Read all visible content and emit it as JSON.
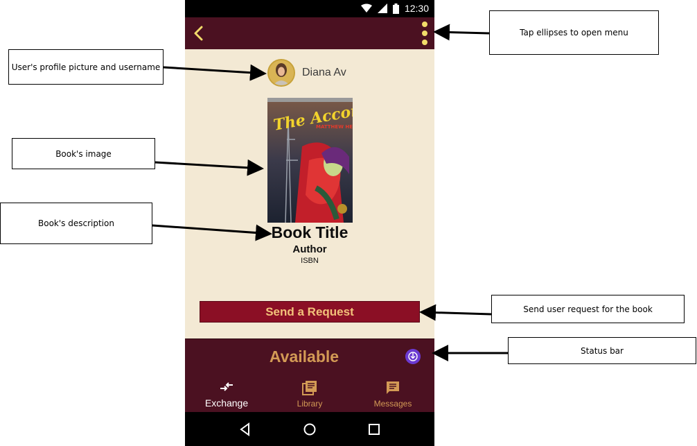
{
  "statusbar": {
    "time": "12:30"
  },
  "appbar": {
    "back_icon": "chevron-left-icon",
    "menu_icon": "vertical-ellipsis-icon"
  },
  "profile": {
    "username": "Diana Av"
  },
  "book": {
    "cover_title": "The Accomplice",
    "cover_author": "MATTHEW HEAD",
    "title": "Book Title",
    "author": "Author",
    "isbn": "ISBN"
  },
  "actions": {
    "request_label": "Send a Request"
  },
  "status": {
    "label": "Available",
    "icon": "download-circle-icon"
  },
  "bottom_nav": {
    "items": [
      {
        "label": "Exchange",
        "icon": "swap-arrows-icon",
        "active": true
      },
      {
        "label": "Library",
        "icon": "library-icon",
        "active": false
      },
      {
        "label": "Messages",
        "icon": "message-icon",
        "active": false
      }
    ]
  },
  "annotations": {
    "menu": "Tap ellipses to open menu",
    "profile": "User's profile picture and username",
    "image": "Book's image",
    "description": "Book's description",
    "request": "Send user request for the book",
    "status": "Status bar"
  },
  "colors": {
    "appbar": "#4b1121",
    "background": "#f3e9d4",
    "button": "#8b0f25",
    "accent_text": "#d39a55",
    "menu_dots": "#f2dc6a"
  }
}
